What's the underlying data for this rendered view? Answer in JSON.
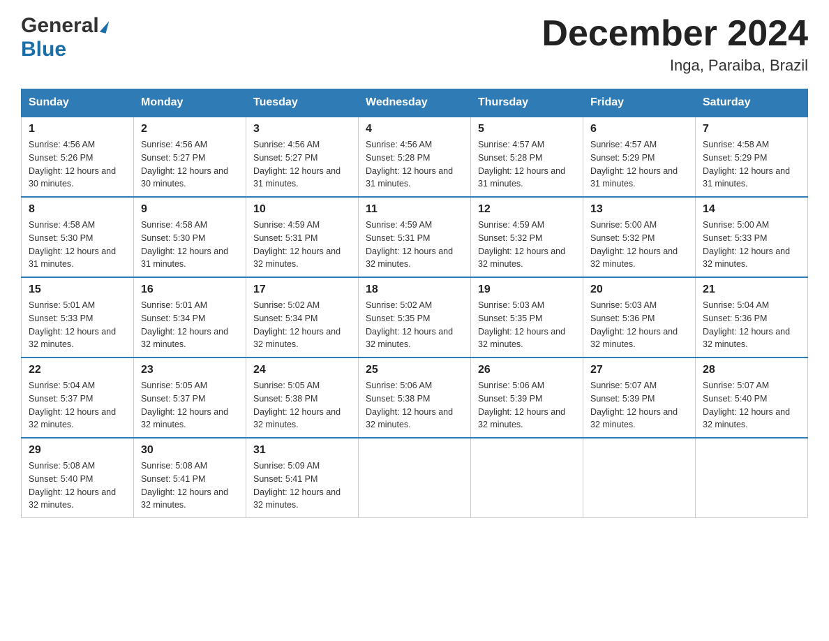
{
  "logo": {
    "general": "General",
    "blue": "Blue"
  },
  "title": "December 2024",
  "subtitle": "Inga, Paraiba, Brazil",
  "days": [
    "Sunday",
    "Monday",
    "Tuesday",
    "Wednesday",
    "Thursday",
    "Friday",
    "Saturday"
  ],
  "weeks": [
    {
      "cells": [
        {
          "day": "1",
          "sunrise": "4:56 AM",
          "sunset": "5:26 PM",
          "daylight": "12 hours and 30 minutes."
        },
        {
          "day": "2",
          "sunrise": "4:56 AM",
          "sunset": "5:27 PM",
          "daylight": "12 hours and 30 minutes."
        },
        {
          "day": "3",
          "sunrise": "4:56 AM",
          "sunset": "5:27 PM",
          "daylight": "12 hours and 31 minutes."
        },
        {
          "day": "4",
          "sunrise": "4:56 AM",
          "sunset": "5:28 PM",
          "daylight": "12 hours and 31 minutes."
        },
        {
          "day": "5",
          "sunrise": "4:57 AM",
          "sunset": "5:28 PM",
          "daylight": "12 hours and 31 minutes."
        },
        {
          "day": "6",
          "sunrise": "4:57 AM",
          "sunset": "5:29 PM",
          "daylight": "12 hours and 31 minutes."
        },
        {
          "day": "7",
          "sunrise": "4:58 AM",
          "sunset": "5:29 PM",
          "daylight": "12 hours and 31 minutes."
        }
      ]
    },
    {
      "cells": [
        {
          "day": "8",
          "sunrise": "4:58 AM",
          "sunset": "5:30 PM",
          "daylight": "12 hours and 31 minutes."
        },
        {
          "day": "9",
          "sunrise": "4:58 AM",
          "sunset": "5:30 PM",
          "daylight": "12 hours and 31 minutes."
        },
        {
          "day": "10",
          "sunrise": "4:59 AM",
          "sunset": "5:31 PM",
          "daylight": "12 hours and 32 minutes."
        },
        {
          "day": "11",
          "sunrise": "4:59 AM",
          "sunset": "5:31 PM",
          "daylight": "12 hours and 32 minutes."
        },
        {
          "day": "12",
          "sunrise": "4:59 AM",
          "sunset": "5:32 PM",
          "daylight": "12 hours and 32 minutes."
        },
        {
          "day": "13",
          "sunrise": "5:00 AM",
          "sunset": "5:32 PM",
          "daylight": "12 hours and 32 minutes."
        },
        {
          "day": "14",
          "sunrise": "5:00 AM",
          "sunset": "5:33 PM",
          "daylight": "12 hours and 32 minutes."
        }
      ]
    },
    {
      "cells": [
        {
          "day": "15",
          "sunrise": "5:01 AM",
          "sunset": "5:33 PM",
          "daylight": "12 hours and 32 minutes."
        },
        {
          "day": "16",
          "sunrise": "5:01 AM",
          "sunset": "5:34 PM",
          "daylight": "12 hours and 32 minutes."
        },
        {
          "day": "17",
          "sunrise": "5:02 AM",
          "sunset": "5:34 PM",
          "daylight": "12 hours and 32 minutes."
        },
        {
          "day": "18",
          "sunrise": "5:02 AM",
          "sunset": "5:35 PM",
          "daylight": "12 hours and 32 minutes."
        },
        {
          "day": "19",
          "sunrise": "5:03 AM",
          "sunset": "5:35 PM",
          "daylight": "12 hours and 32 minutes."
        },
        {
          "day": "20",
          "sunrise": "5:03 AM",
          "sunset": "5:36 PM",
          "daylight": "12 hours and 32 minutes."
        },
        {
          "day": "21",
          "sunrise": "5:04 AM",
          "sunset": "5:36 PM",
          "daylight": "12 hours and 32 minutes."
        }
      ]
    },
    {
      "cells": [
        {
          "day": "22",
          "sunrise": "5:04 AM",
          "sunset": "5:37 PM",
          "daylight": "12 hours and 32 minutes."
        },
        {
          "day": "23",
          "sunrise": "5:05 AM",
          "sunset": "5:37 PM",
          "daylight": "12 hours and 32 minutes."
        },
        {
          "day": "24",
          "sunrise": "5:05 AM",
          "sunset": "5:38 PM",
          "daylight": "12 hours and 32 minutes."
        },
        {
          "day": "25",
          "sunrise": "5:06 AM",
          "sunset": "5:38 PM",
          "daylight": "12 hours and 32 minutes."
        },
        {
          "day": "26",
          "sunrise": "5:06 AM",
          "sunset": "5:39 PM",
          "daylight": "12 hours and 32 minutes."
        },
        {
          "day": "27",
          "sunrise": "5:07 AM",
          "sunset": "5:39 PM",
          "daylight": "12 hours and 32 minutes."
        },
        {
          "day": "28",
          "sunrise": "5:07 AM",
          "sunset": "5:40 PM",
          "daylight": "12 hours and 32 minutes."
        }
      ]
    },
    {
      "cells": [
        {
          "day": "29",
          "sunrise": "5:08 AM",
          "sunset": "5:40 PM",
          "daylight": "12 hours and 32 minutes."
        },
        {
          "day": "30",
          "sunrise": "5:08 AM",
          "sunset": "5:41 PM",
          "daylight": "12 hours and 32 minutes."
        },
        {
          "day": "31",
          "sunrise": "5:09 AM",
          "sunset": "5:41 PM",
          "daylight": "12 hours and 32 minutes."
        },
        null,
        null,
        null,
        null
      ]
    }
  ]
}
